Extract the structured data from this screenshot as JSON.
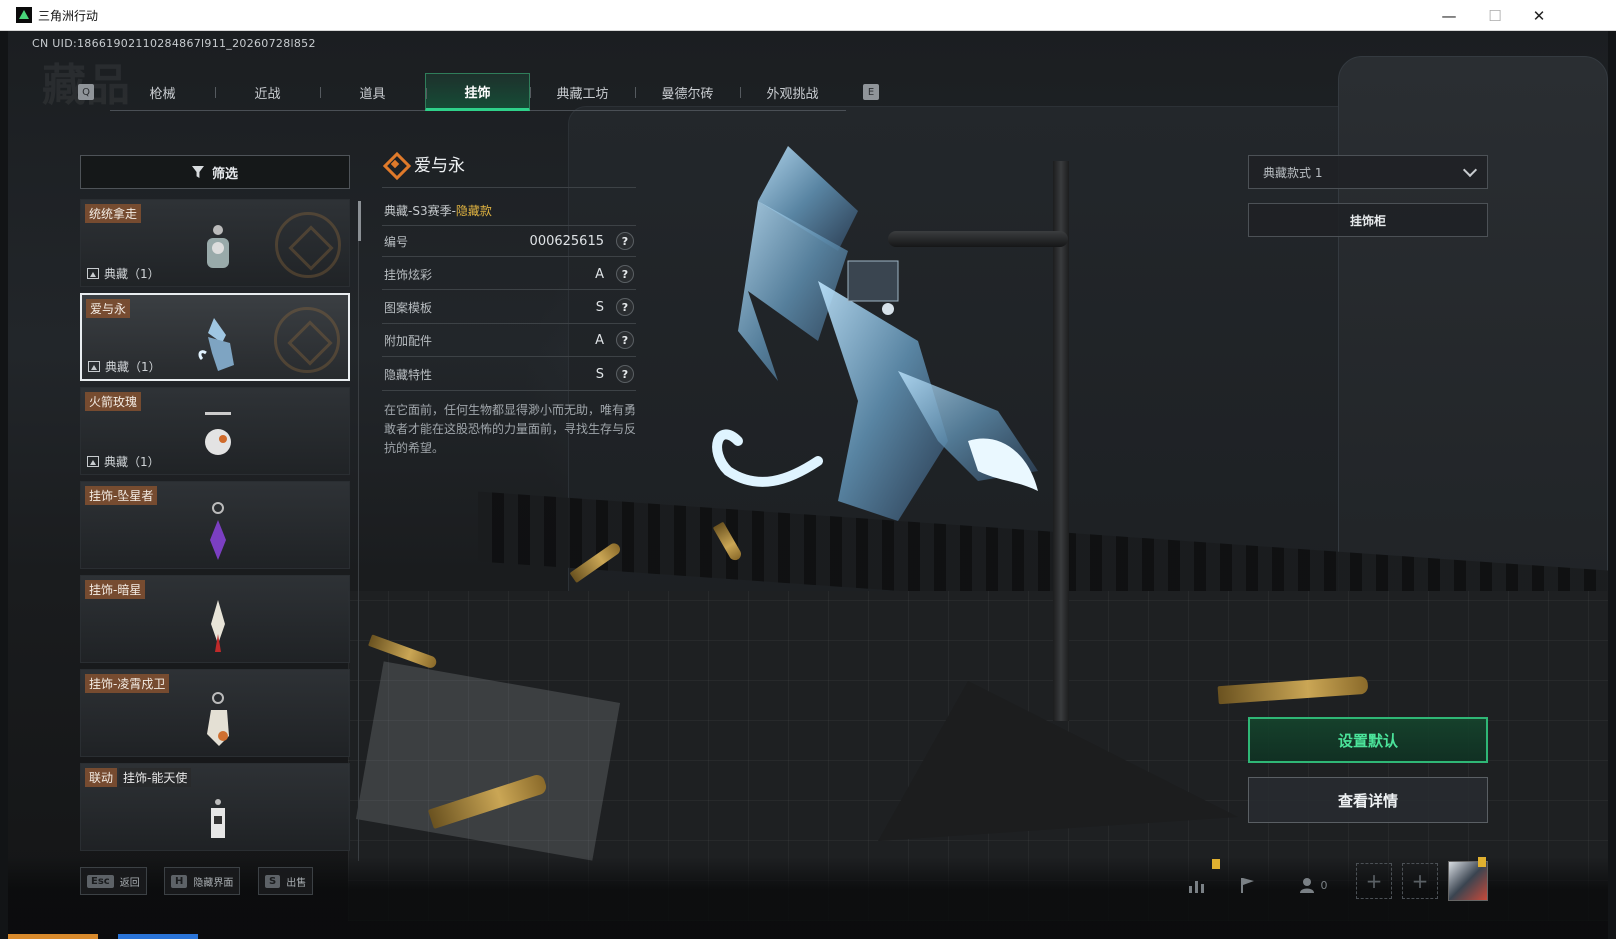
{
  "window": {
    "title": "三角洲行动",
    "minimize": "—",
    "maximize": "☐",
    "close": "✕"
  },
  "uid": "CN UID:18661902110284867l911_20260728l852",
  "tabs": {
    "left_key": "Q",
    "right_key": "E",
    "items": [
      {
        "label": "枪械",
        "active": false
      },
      {
        "label": "近战",
        "active": false
      },
      {
        "label": "道具",
        "active": false
      },
      {
        "label": "挂饰",
        "active": true
      },
      {
        "label": "典藏工坊",
        "active": false
      },
      {
        "label": "曼德尔砖",
        "active": false
      },
      {
        "label": "外观挑战",
        "active": false
      }
    ]
  },
  "filter": {
    "label": "筛选"
  },
  "list": [
    {
      "tag": "统统拿走",
      "meta": "典藏（1）",
      "selected": false,
      "emblem": true
    },
    {
      "tag": "爱与永",
      "meta": "典藏（1）",
      "selected": true,
      "emblem": true
    },
    {
      "tag": "火箭玫瑰",
      "meta": "典藏（1）",
      "selected": false,
      "emblem": false
    },
    {
      "tag": "挂饰-坠星者",
      "meta": "",
      "selected": false,
      "emblem": false
    },
    {
      "tag": "挂饰-暗星",
      "meta": "",
      "selected": false,
      "emblem": false
    },
    {
      "tag": "挂饰-凌霄戍卫",
      "meta": "",
      "selected": false,
      "emblem": false
    },
    {
      "tag": "联动",
      "tag2": "挂饰-能天使",
      "meta": "",
      "selected": false,
      "emblem": false
    }
  ],
  "detail": {
    "name": "爱与永",
    "subtitle_prefix": "典藏-S3赛季-",
    "subtitle_hidden": "隐藏款",
    "rows": [
      {
        "label": "编号",
        "value": "000625615"
      },
      {
        "label": "挂饰炫彩",
        "value": "A"
      },
      {
        "label": "图案模板",
        "value": "S"
      },
      {
        "label": "附加配件",
        "value": "A"
      },
      {
        "label": "隐藏特性",
        "value": "S"
      }
    ],
    "help_glyph": "?",
    "description": "在它面前，任何生物都显得渺小而无助，唯有勇敢者才能在这股恐怖的力量面前，寻找生存与反抗的希望。"
  },
  "right_panel": {
    "style_select": "典藏款式 1",
    "cabinet": "挂饰柜",
    "set_default": "设置默认",
    "view_details": "查看详情"
  },
  "bottom": {
    "hotkeys": [
      {
        "key": "Esc",
        "label": "返回"
      },
      {
        "key": "H",
        "label": "隐藏界面"
      },
      {
        "key": "S",
        "label": "出售"
      }
    ],
    "friend_count": "0",
    "slot_plus": "+"
  },
  "colors": {
    "accent_green": "#2fd18a",
    "hidden_gold": "#e0b341",
    "tag_brown": "#7d4e30",
    "emblem_orange": "#e07a2a"
  }
}
